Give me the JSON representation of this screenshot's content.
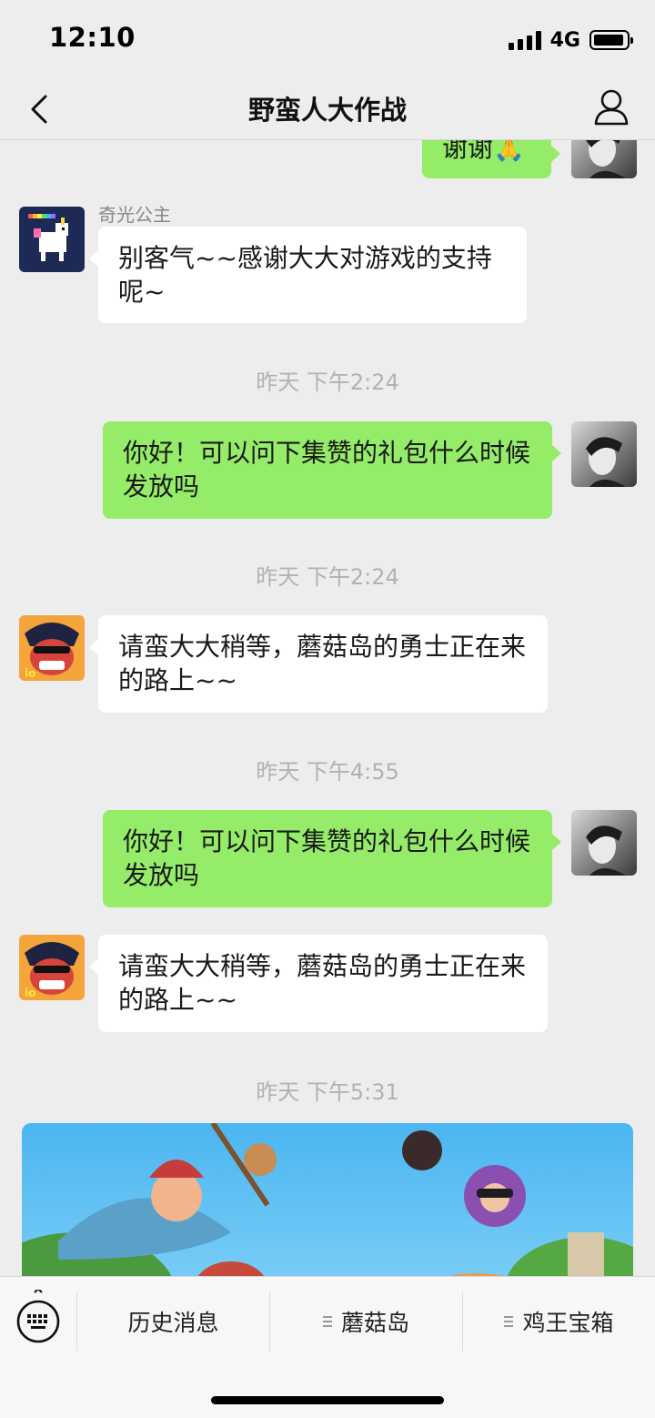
{
  "status_bar": {
    "time": "12:10",
    "network": "4G"
  },
  "nav": {
    "title": "野蛮人大作战",
    "back_icon": "chevron-left-icon",
    "profile_icon": "user-icon"
  },
  "messages": [
    {
      "type": "text",
      "direction": "out",
      "text": "谢谢🙏",
      "avatar": "user-avatar"
    },
    {
      "type": "text",
      "direction": "in",
      "sender": "奇光公主",
      "text": "别客气~~感谢大大对游戏的支持呢~",
      "avatar": "unicorn-avatar"
    },
    {
      "type": "timestamp",
      "text": "昨天 下午2:24"
    },
    {
      "type": "text",
      "direction": "out",
      "text": "你好！可以问下集赞的礼包什么时候发放吗",
      "avatar": "user-avatar"
    },
    {
      "type": "timestamp",
      "text": "昨天 下午2:24"
    },
    {
      "type": "text",
      "direction": "in",
      "text": "请蛮大大稍等，蘑菇岛的勇士正在来的路上~~",
      "avatar": "barbarian-avatar"
    },
    {
      "type": "timestamp",
      "text": "昨天 下午4:55"
    },
    {
      "type": "text",
      "direction": "out",
      "text": "你好！可以问下集赞的礼包什么时候发放吗",
      "avatar": "user-avatar"
    },
    {
      "type": "text",
      "direction": "in",
      "text": "请蛮大大稍等，蘑菇岛的勇士正在来的路上~~",
      "avatar": "barbarian-avatar"
    },
    {
      "type": "timestamp",
      "text": "昨天 下午5:31"
    },
    {
      "type": "image",
      "direction": "in",
      "description_icon": "game-banner-image"
    }
  ],
  "bottom_menu": {
    "keyboard_icon": "keyboard-icon",
    "items": [
      {
        "label": "历史消息",
        "has_submenu": false
      },
      {
        "label": "蘑菇岛",
        "has_submenu": true
      },
      {
        "label": "鸡王宝箱",
        "has_submenu": true
      }
    ]
  },
  "colors": {
    "background": "#ededed",
    "incoming_bubble": "#ffffff",
    "outgoing_bubble": "#95ec69",
    "timestamp": "#b2b2b2"
  }
}
